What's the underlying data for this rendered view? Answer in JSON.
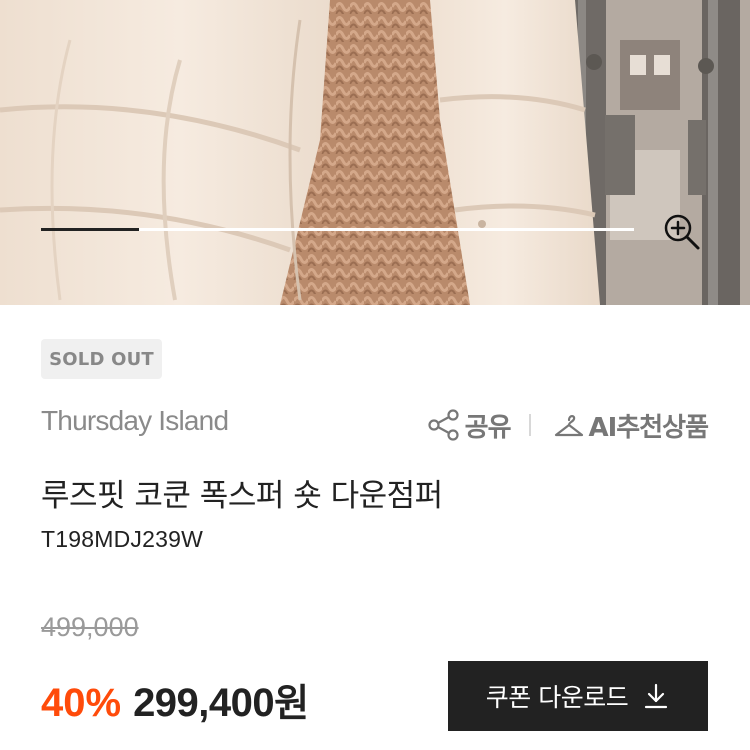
{
  "hero": {
    "gallery_progress": 0.165,
    "zoom_icon": "zoom-in-icon"
  },
  "product": {
    "badge": "SOLD OUT",
    "brand": "Thursday Island",
    "name": "루즈핏 코쿤 폭스퍼 숏 다운점퍼",
    "code": "T198MDJ239W",
    "original_price": "499,000",
    "discount": "40%",
    "price": "299,400",
    "price_unit": "원"
  },
  "actions": {
    "share_label": "공유",
    "share_icon": "share-icon",
    "ai_label": "AI추천상품",
    "ai_icon": "hanger-icon"
  },
  "coupon": {
    "label": "쿠폰 다운로드",
    "icon": "download-icon"
  },
  "colors": {
    "discount": "#ff4b0a",
    "button_bg": "#222222",
    "badge_bg": "#f0f0f0"
  }
}
